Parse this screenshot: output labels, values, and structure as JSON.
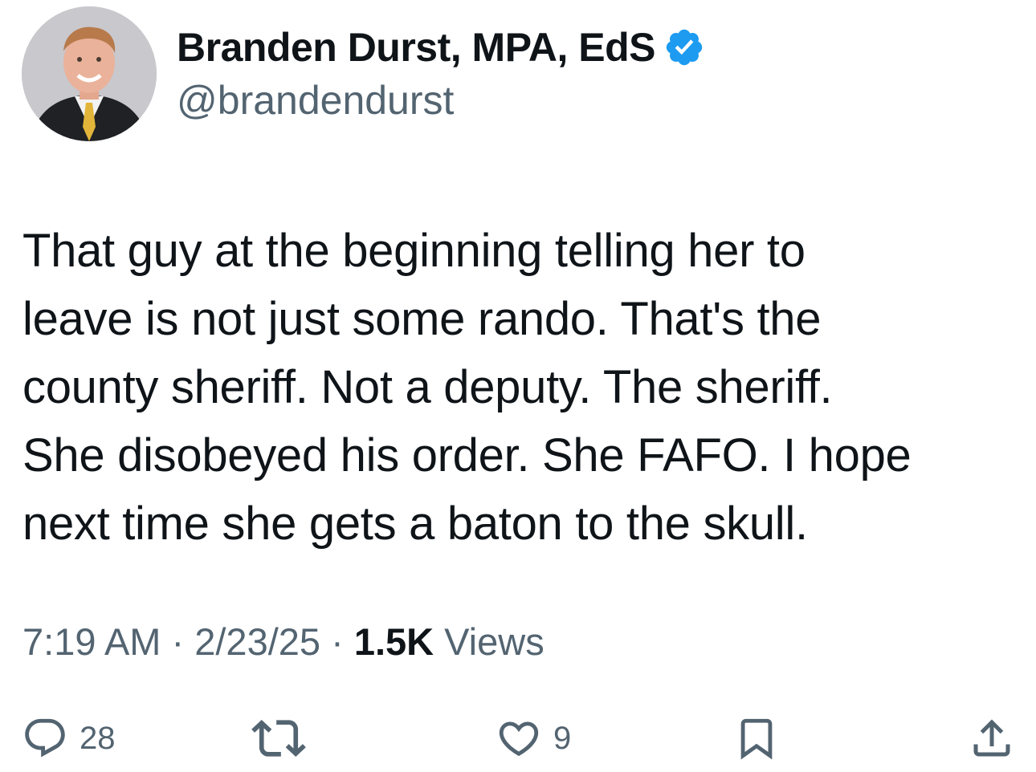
{
  "author": {
    "display_name": "Branden Durst, MPA, EdS",
    "handle": "@brandendurst",
    "verified_color": "#1d9bf0"
  },
  "tweet": {
    "lines": [
      "That guy at the beginning telling her to",
      "leave is not just some rando. That's the",
      "county sheriff. Not a deputy. The sheriff.",
      "She disobeyed his order. She FAFO. I hope",
      "next time she gets a baton to the skull."
    ]
  },
  "meta": {
    "time": "7:19 AM",
    "separator": "·",
    "date": "2/23/25",
    "views_count": "1.5K",
    "views_label": "Views"
  },
  "actions": {
    "reply_count": "28",
    "like_count": "9"
  },
  "icons": {
    "reply": "reply-icon",
    "retweet": "retweet-icon",
    "like": "heart-icon",
    "bookmark": "bookmark-icon",
    "share": "share-icon",
    "verified": "verified-badge-icon"
  }
}
